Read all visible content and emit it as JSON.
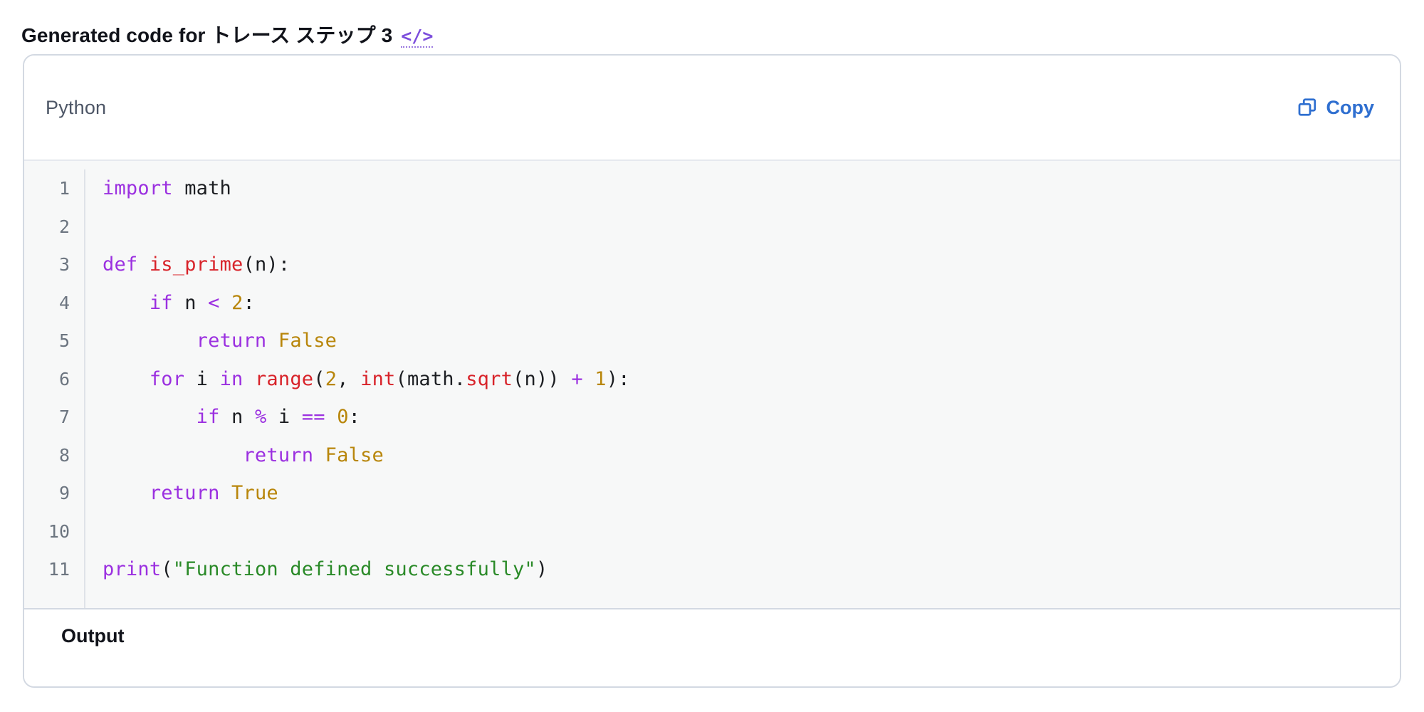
{
  "header": {
    "title": "Generated code for トレース ステップ 3",
    "code_tag_icon": "code-tag-icon",
    "code_tag_glyph": "</>"
  },
  "card": {
    "language": "Python",
    "copy_label": "Copy",
    "copy_icon": "copy-icon",
    "output_label": "Output"
  },
  "colors": {
    "accent_blue": "#2f6fd0",
    "accent_purple": "#7c4ddc",
    "keyword": "#9b30e0",
    "function": "#d8232a",
    "number": "#b8860b",
    "string": "#2a8a28",
    "plain": "#1c1e22",
    "border": "#d3d9e2",
    "code_bg": "#f7f8f8"
  },
  "code": {
    "language": "Python",
    "line_numbers": [
      1,
      2,
      3,
      4,
      5,
      6,
      7,
      8,
      9,
      10,
      11
    ],
    "lines": [
      "import math",
      "",
      "def is_prime(n):",
      "    if n < 2:",
      "        return False",
      "    for i in range(2, int(math.sqrt(n)) + 1):",
      "        if n % i == 0:",
      "            return False",
      "    return True",
      "",
      "print(\"Function defined successfully\")"
    ],
    "tokens": [
      [
        {
          "t": "import",
          "c": "kw"
        },
        {
          "t": " math",
          "c": "pl"
        }
      ],
      [],
      [
        {
          "t": "def",
          "c": "kw"
        },
        {
          "t": " ",
          "c": "pl"
        },
        {
          "t": "is_prime",
          "c": "fn"
        },
        {
          "t": "(n):",
          "c": "pl"
        }
      ],
      [
        {
          "t": "    ",
          "c": "pl"
        },
        {
          "t": "if",
          "c": "kw"
        },
        {
          "t": " n ",
          "c": "pl"
        },
        {
          "t": "<",
          "c": "op"
        },
        {
          "t": " ",
          "c": "pl"
        },
        {
          "t": "2",
          "c": "num"
        },
        {
          "t": ":",
          "c": "pl"
        }
      ],
      [
        {
          "t": "        ",
          "c": "pl"
        },
        {
          "t": "return",
          "c": "kw"
        },
        {
          "t": " ",
          "c": "pl"
        },
        {
          "t": "False",
          "c": "const"
        }
      ],
      [
        {
          "t": "    ",
          "c": "pl"
        },
        {
          "t": "for",
          "c": "kw"
        },
        {
          "t": " i ",
          "c": "pl"
        },
        {
          "t": "in",
          "c": "kw"
        },
        {
          "t": " ",
          "c": "pl"
        },
        {
          "t": "range",
          "c": "bi"
        },
        {
          "t": "(",
          "c": "pl"
        },
        {
          "t": "2",
          "c": "num"
        },
        {
          "t": ", ",
          "c": "pl"
        },
        {
          "t": "int",
          "c": "bi"
        },
        {
          "t": "(math.",
          "c": "pl"
        },
        {
          "t": "sqrt",
          "c": "bi"
        },
        {
          "t": "(n)) ",
          "c": "pl"
        },
        {
          "t": "+",
          "c": "op"
        },
        {
          "t": " ",
          "c": "pl"
        },
        {
          "t": "1",
          "c": "num"
        },
        {
          "t": "):",
          "c": "pl"
        }
      ],
      [
        {
          "t": "        ",
          "c": "pl"
        },
        {
          "t": "if",
          "c": "kw"
        },
        {
          "t": " n ",
          "c": "pl"
        },
        {
          "t": "%",
          "c": "op"
        },
        {
          "t": " i ",
          "c": "pl"
        },
        {
          "t": "==",
          "c": "op"
        },
        {
          "t": " ",
          "c": "pl"
        },
        {
          "t": "0",
          "c": "num"
        },
        {
          "t": ":",
          "c": "pl"
        }
      ],
      [
        {
          "t": "            ",
          "c": "pl"
        },
        {
          "t": "return",
          "c": "kw"
        },
        {
          "t": " ",
          "c": "pl"
        },
        {
          "t": "False",
          "c": "const"
        }
      ],
      [
        {
          "t": "    ",
          "c": "pl"
        },
        {
          "t": "return",
          "c": "kw"
        },
        {
          "t": " ",
          "c": "pl"
        },
        {
          "t": "True",
          "c": "const"
        }
      ],
      [],
      [
        {
          "t": "print",
          "c": "print"
        },
        {
          "t": "(",
          "c": "pl"
        },
        {
          "t": "\"Function defined successfully\"",
          "c": "str"
        },
        {
          "t": ")",
          "c": "pl"
        }
      ]
    ]
  }
}
